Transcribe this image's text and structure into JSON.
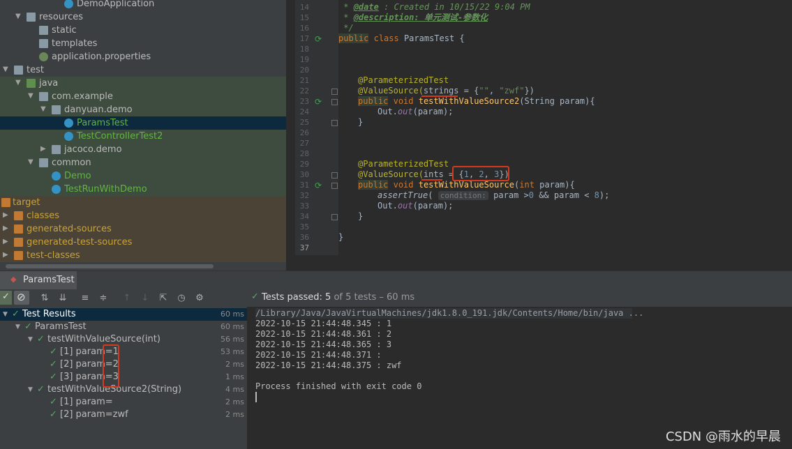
{
  "project_tree": {
    "items": [
      {
        "label": "DemoApplication",
        "icon": "spring-class-icon"
      },
      {
        "label": "resources",
        "icon": "folder-icon"
      },
      {
        "label": "static",
        "icon": "folder-icon"
      },
      {
        "label": "templates",
        "icon": "folder-icon"
      },
      {
        "label": "application.properties",
        "icon": "properties-file-icon"
      },
      {
        "label": "test",
        "icon": "folder-icon"
      },
      {
        "label": "java",
        "icon": "test-source-folder-icon"
      },
      {
        "label": "com.example",
        "icon": "package-icon"
      },
      {
        "label": "danyuan.demo",
        "icon": "package-icon"
      },
      {
        "label": "ParamsTest",
        "icon": "class-icon"
      },
      {
        "label": "TestControllerTest2",
        "icon": "class-icon"
      },
      {
        "label": "jacoco.demo",
        "icon": "package-icon"
      },
      {
        "label": "common",
        "icon": "package-icon"
      },
      {
        "label": "Demo",
        "icon": "class-icon"
      },
      {
        "label": "TestRunWithDemo",
        "icon": "class-icon"
      },
      {
        "label": "target",
        "icon": "excluded-folder-icon"
      },
      {
        "label": "classes",
        "icon": "excluded-folder-icon"
      },
      {
        "label": "generated-sources",
        "icon": "excluded-folder-icon"
      },
      {
        "label": "generated-test-sources",
        "icon": "excluded-folder-icon"
      },
      {
        "label": "test-classes",
        "icon": "excluded-folder-icon"
      }
    ]
  },
  "editor": {
    "line_numbers": [
      "14",
      "15",
      "16",
      "17",
      "18",
      "19",
      "20",
      "21",
      "22",
      "23",
      "24",
      "25",
      "26",
      "27",
      "28",
      "29",
      "30",
      "31",
      "32",
      "33",
      "34",
      "35",
      "36",
      "37"
    ],
    "l14_tag": "@date",
    "l14_text": " : Created in 10/15/22 9:04 PM",
    "l15_tag": "@description",
    "l15_text": ": 单元测试-参数化",
    "l16": " */",
    "l17_kw1": "public",
    "l17_kw2": "class",
    "l17_name": " ParamsTest {",
    "l22": "@ParameterizedTest",
    "l23_ann": "@ValueSource(",
    "l23_attr": "strings",
    "l23_eq": " = {",
    "l23_s1": "\"\"",
    "l23_c": ", ",
    "l23_s2": "\"zwf\"",
    "l23_end": "})",
    "l24_kw": "public",
    "l24_void": "void",
    "l24_fn": "testWithValueSource2",
    "l24_rest": "(String param){",
    "l25_a": "Out.",
    "l25_b": "out",
    "l25_c": "(param);",
    "l26": "}",
    "l29": "@ParameterizedTest",
    "l30_ann": "@ValueSource(",
    "l30_attr": "ints",
    "l30_eq": " = {",
    "l30_n1": "1",
    "l30_c1": ", ",
    "l30_n2": "2",
    "l30_c2": ", ",
    "l30_n3": "3",
    "l30_end": "})",
    "l31_kw": "public",
    "l31_void": "void",
    "l31_fn": "testWithValueSource",
    "l31_int": "int",
    "l31_rest": " param){",
    "l32_fn": "assertTrue",
    "l32_open": "( ",
    "l32_hint": "condition:",
    "l32_rest": " param >",
    "l32_n0": "0",
    "l32_and": " && param < ",
    "l32_n8": "8",
    "l32_end": ");",
    "l33_a": "Out.",
    "l33_b": "out",
    "l33_c": "(param);",
    "l34": "}",
    "l36": "}"
  },
  "run_panel": {
    "tab_label": "ParamsTest",
    "status_prefix": "Tests passed:",
    "status_count": "5",
    "status_rest": "of 5 tests – 60 ms"
  },
  "results": [
    {
      "label": "Test Results",
      "time": "60 ms"
    },
    {
      "label": "ParamsTest",
      "time": "60 ms"
    },
    {
      "label": "testWithValueSource(int)",
      "time": "56 ms"
    },
    {
      "label": "[1] param=1",
      "time": "53 ms"
    },
    {
      "label": "[2] param=2",
      "time": "2 ms"
    },
    {
      "label": "[3] param=3",
      "time": "1 ms"
    },
    {
      "label": "testWithValueSource2(String)",
      "time": "4 ms"
    },
    {
      "label": "[1] param=",
      "time": "2 ms"
    },
    {
      "label": "[2] param=zwf",
      "time": "2 ms"
    }
  ],
  "console": {
    "lines": [
      "/Library/Java/JavaVirtualMachines/jdk1.8.0_191.jdk/Contents/Home/bin/java ...",
      "2022-10-15 21:44:48.345 : 1",
      "2022-10-15 21:44:48.361 : 2",
      "2022-10-15 21:44:48.365 : 3",
      "2022-10-15 21:44:48.371 :",
      "2022-10-15 21:44:48.375 : zwf",
      "",
      "Process finished with exit code 0"
    ]
  },
  "watermark": "CSDN @雨水的早晨",
  "colors": {
    "accent_green": "#59a869",
    "selection": "#0d293e",
    "highlight_red": "#d63a1e"
  }
}
